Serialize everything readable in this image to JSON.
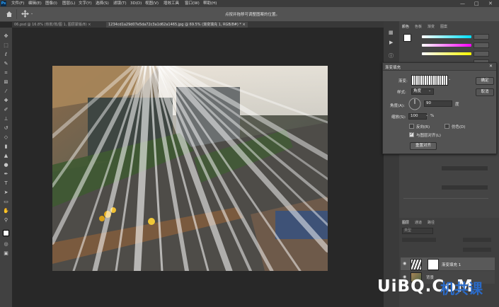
{
  "menu": {
    "items": [
      "文件(F)",
      "编辑(E)",
      "图像(I)",
      "图层(L)",
      "文字(Y)",
      "选择(S)",
      "滤镜(T)",
      "3D(D)",
      "视图(V)",
      "增效工具",
      "窗口(W)",
      "帮助(H)"
    ],
    "app_icon": "Ps",
    "window_controls": [
      "—",
      "□",
      "✕"
    ]
  },
  "options_bar": {
    "hint": "点按并拖移可调整图案的位置。",
    "home_icon": "home-icon",
    "move_icon": "move-icon"
  },
  "tabs": [
    {
      "label": "06.psd @ 16.8% (热煎/煎/图 1, 图层蒙版/8) ×"
    },
    {
      "label": "1234cd1a29d07e5da72c3a1d62a1465.jpg @ 69.5% (渐变填充 1, RGB/8#) * ×"
    }
  ],
  "dialog": {
    "title": "渐变填充",
    "gradient_label": "渐变:",
    "style_label": "样式:",
    "style_value": "角度",
    "angle_label": "角度(A):",
    "angle_value": "90",
    "angle_unit": "度",
    "scale_label": "缩放(S):",
    "scale_value": "100",
    "scale_unit": "%",
    "reverse_label": "反向(R)",
    "dither_label": "仿色(D)",
    "align_label": "与图层对齐(L)",
    "reset_align_label": "重置对齐",
    "ok_label": "确定",
    "cancel_label": "取消",
    "close_icon": "close-icon"
  },
  "right_panel": {
    "tabs": [
      "颜色",
      "色板",
      "渐变",
      "图案"
    ],
    "swatch_colors": {
      "foreground": "#ffffff",
      "background": "#000000"
    }
  },
  "layers": {
    "tabs": [
      "图层",
      "通道",
      "路径"
    ],
    "search_placeholder": "类型",
    "rows": [
      {
        "name": "渐变填充 1"
      },
      {
        "name": "背景"
      }
    ]
  },
  "watermark": {
    "latin": "UiBQ.CoM",
    "cjk": "机共课"
  },
  "colors": {
    "accent_cyan": "#00e0ff",
    "accent_magenta": "#ff00ff",
    "accent_yellow": "#ffff00"
  }
}
